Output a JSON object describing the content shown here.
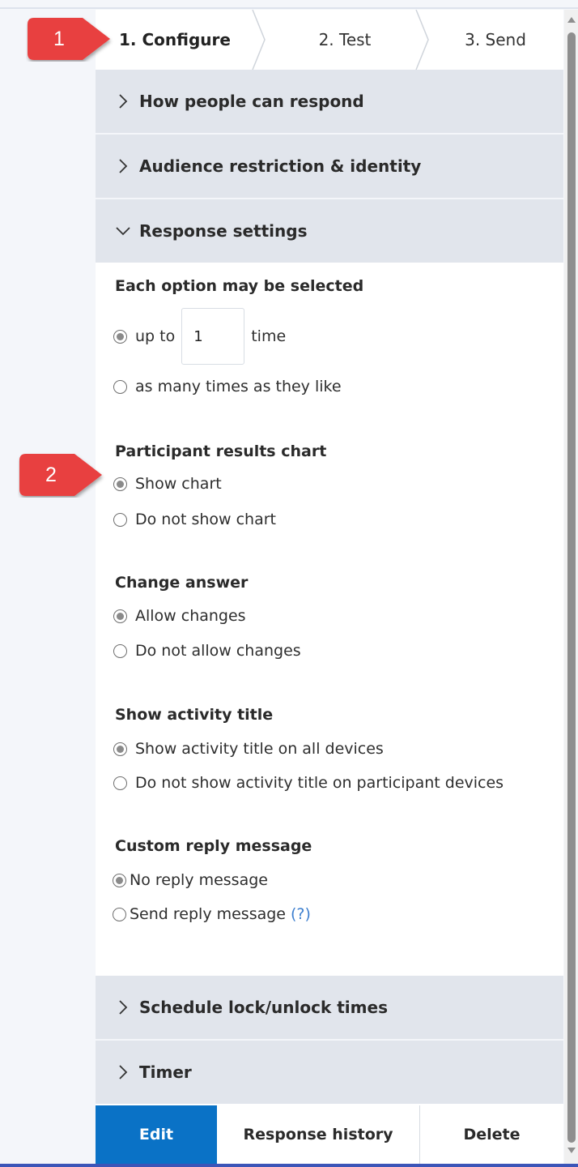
{
  "stepper": {
    "steps": [
      {
        "label": "1. Configure",
        "active": true
      },
      {
        "label": "2. Test",
        "active": false
      },
      {
        "label": "3. Send",
        "active": false
      }
    ]
  },
  "accordion": {
    "how_people_respond": "How people can respond",
    "audience": "Audience restriction & identity",
    "response_settings": "Response settings",
    "schedule": "Schedule lock/unlock times",
    "timer": "Timer"
  },
  "settings": {
    "each_option": {
      "title": "Each option may be selected",
      "up_to_label": "up to",
      "up_to_value": "1",
      "time_label": "time",
      "many_label": "as many times as they like"
    },
    "results_chart": {
      "title": "Participant results chart",
      "show": "Show chart",
      "hide": "Do not show chart"
    },
    "change_answer": {
      "title": "Change answer",
      "allow": "Allow changes",
      "disallow": "Do not allow changes"
    },
    "activity_title": {
      "title": "Show activity title",
      "show_all": "Show activity title on all devices",
      "hide_participant": "Do not show activity title on participant devices"
    },
    "reply_message": {
      "title": "Custom reply message",
      "none": "No reply message",
      "send": "Send reply message",
      "help": "(?)"
    }
  },
  "buttons": {
    "edit": "Edit",
    "history": "Response history",
    "delete": "Delete"
  },
  "callouts": [
    "1",
    "2"
  ],
  "colors": {
    "accordion_bg": "#e1e5ec",
    "primary": "#0a72c6",
    "callout": "#e8403f",
    "help_link": "#3d7fcf"
  }
}
